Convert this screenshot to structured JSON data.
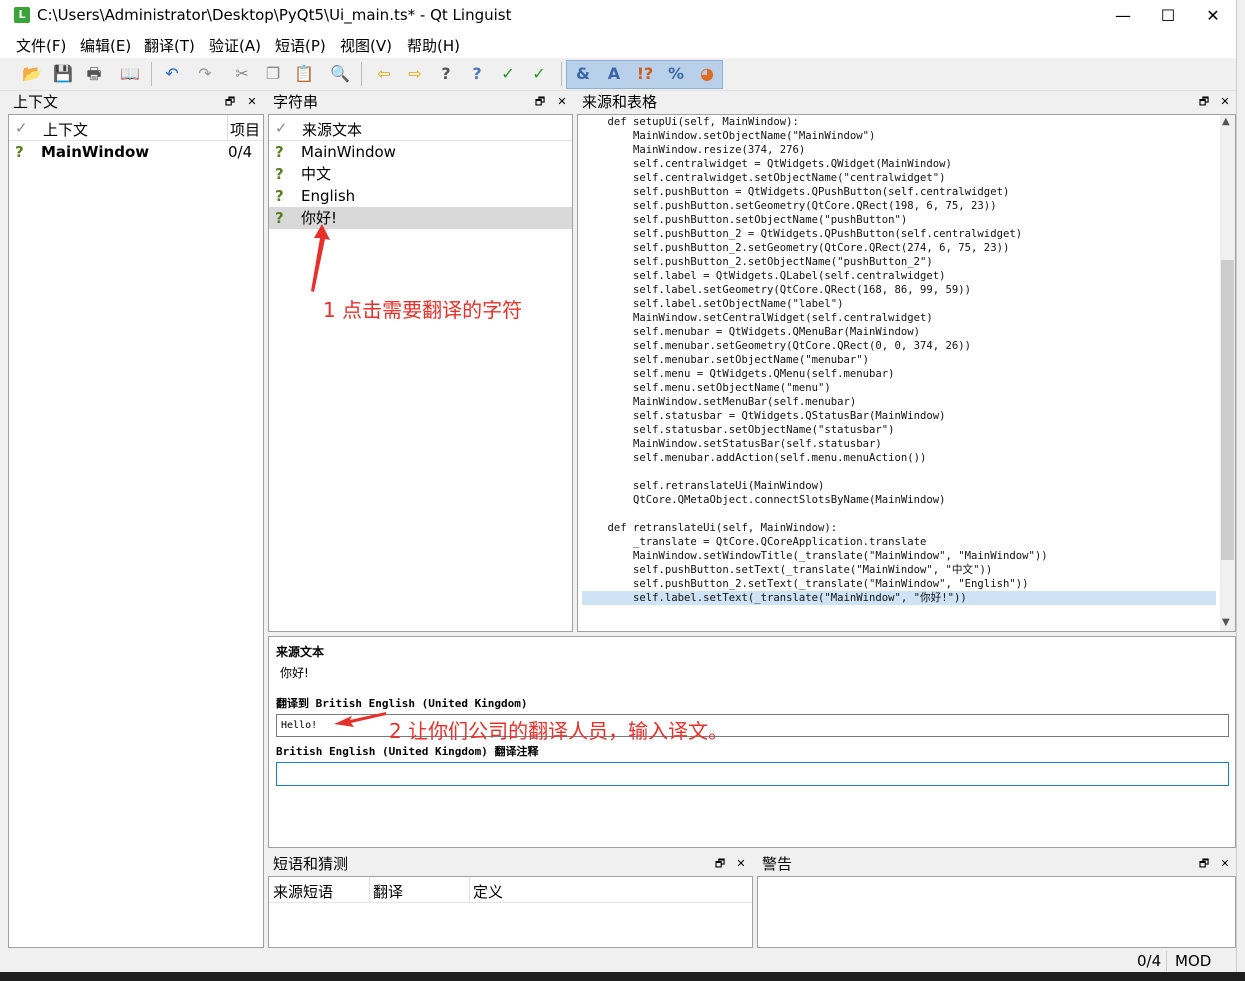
{
  "window": {
    "title": "C:\\Users\\Administrator\\Desktop\\PyQt5\\Ui_main.ts* - Qt Linguist",
    "app_icon": "L",
    "min": "—",
    "max": "☐",
    "close": "✕"
  },
  "menus": [
    "文件(F)",
    "编辑(E)",
    "翻译(T)",
    "验证(A)",
    "短语(P)",
    "视图(V)",
    "帮助(H)"
  ],
  "context_pane": {
    "title": "上下文",
    "col_context": "上下文",
    "col_items": "项目",
    "rows": [
      {
        "name": "MainWindow",
        "count": "0/4"
      }
    ]
  },
  "strings_pane": {
    "title": "字符串",
    "col_source": "来源文本",
    "rows": [
      "MainWindow",
      "中文",
      "English",
      "你好!"
    ]
  },
  "source_pane": {
    "title": "来源和表格",
    "code_lines": [
      "    def setupUi(self, MainWindow):",
      "        MainWindow.setObjectName(\"MainWindow\")",
      "        MainWindow.resize(374, 276)",
      "        self.centralwidget = QtWidgets.QWidget(MainWindow)",
      "        self.centralwidget.setObjectName(\"centralwidget\")",
      "        self.pushButton = QtWidgets.QPushButton(self.centralwidget)",
      "        self.pushButton.setGeometry(QtCore.QRect(198, 6, 75, 23))",
      "        self.pushButton.setObjectName(\"pushButton\")",
      "        self.pushButton_2 = QtWidgets.QPushButton(self.centralwidget)",
      "        self.pushButton_2.setGeometry(QtCore.QRect(274, 6, 75, 23))",
      "        self.pushButton_2.setObjectName(\"pushButton_2\")",
      "        self.label = QtWidgets.QLabel(self.centralwidget)",
      "        self.label.setGeometry(QtCore.QRect(168, 86, 99, 59))",
      "        self.label.setObjectName(\"label\")",
      "        MainWindow.setCentralWidget(self.centralwidget)",
      "        self.menubar = QtWidgets.QMenuBar(MainWindow)",
      "        self.menubar.setGeometry(QtCore.QRect(0, 0, 374, 26))",
      "        self.menubar.setObjectName(\"menubar\")",
      "        self.menu = QtWidgets.QMenu(self.menubar)",
      "        self.menu.setObjectName(\"menu\")",
      "        MainWindow.setMenuBar(self.menubar)",
      "        self.statusbar = QtWidgets.QStatusBar(MainWindow)",
      "        self.statusbar.setObjectName(\"statusbar\")",
      "        MainWindow.setStatusBar(self.statusbar)",
      "        self.menubar.addAction(self.menu.menuAction())",
      "",
      "        self.retranslateUi(MainWindow)",
      "        QtCore.QMetaObject.connectSlotsByName(MainWindow)",
      "",
      "    def retranslateUi(self, MainWindow):",
      "        _translate = QtCore.QCoreApplication.translate",
      "        MainWindow.setWindowTitle(_translate(\"MainWindow\", \"MainWindow\"))",
      "        self.pushButton.setText(_translate(\"MainWindow\", \"中文\"))",
      "        self.pushButton_2.setText(_translate(\"MainWindow\", \"English\"))",
      "        self.label.setText(_translate(\"MainWindow\", \"你好!\"))"
    ]
  },
  "editor": {
    "source_label": "来源文本",
    "source_text": "你好!",
    "translate_label": "翻译到 British English (United Kingdom)",
    "translation_value": "Hello!",
    "comment_label": "British English (United Kingdom) 翻译注释",
    "comment_value": ""
  },
  "annotations": {
    "step1": "1 点击需要翻译的字符",
    "step2": "2 让你们公司的翻译人员，输入译文。"
  },
  "phrases_pane": {
    "title": "短语和猜测",
    "cols": [
      "来源短语",
      "翻译",
      "定义"
    ]
  },
  "warnings_pane": {
    "title": "警告"
  },
  "statusbar": {
    "progress": "0/4",
    "mode": "MOD"
  },
  "icons": {
    "check": "✓",
    "question": "?",
    "float": "🗗",
    "close": "✕"
  }
}
